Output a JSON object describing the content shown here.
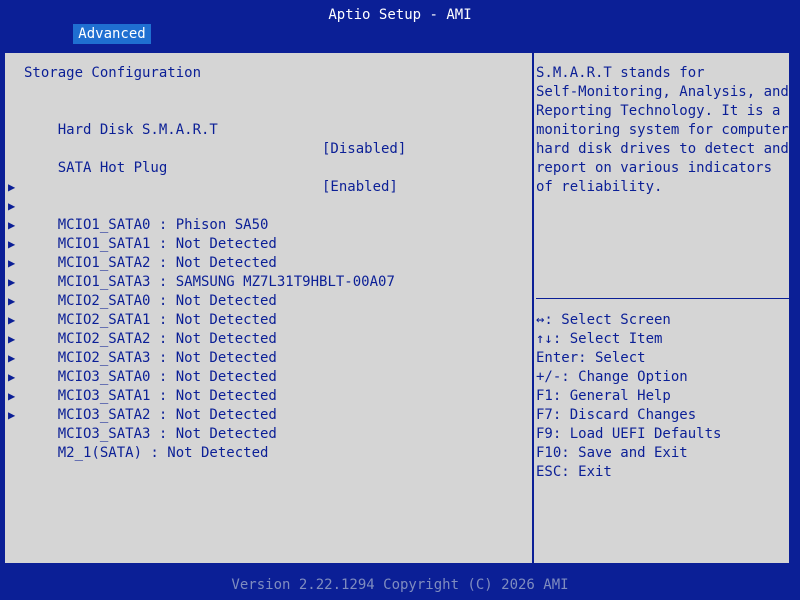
{
  "header": {
    "app_title": "Aptio Setup - AMI",
    "tab_label": "Advanced"
  },
  "main": {
    "section_title": "Storage Configuration",
    "settings": [
      {
        "label": "Hard Disk S.M.A.R.T",
        "value": "[Disabled]"
      },
      {
        "label": "SATA Hot Plug",
        "value": "[Enabled]"
      }
    ],
    "devices": [
      "MCIO1_SATA0 : Phison SA50",
      "MCIO1_SATA1 : Not Detected",
      "MCIO1_SATA2 : Not Detected",
      "MCIO1_SATA3 : SAMSUNG MZ7L31T9HBLT-00A07",
      "MCIO2_SATA0 : Not Detected",
      "MCIO2_SATA1 : Not Detected",
      "MCIO2_SATA2 : Not Detected",
      "MCIO2_SATA3 : Not Detected",
      "MCIO3_SATA0 : Not Detected",
      "MCIO3_SATA1 : Not Detected",
      "MCIO3_SATA2 : Not Detected",
      "MCIO3_SATA3 : Not Detected",
      "M2_1(SATA) : Not Detected"
    ]
  },
  "help": {
    "description": [
      "S.M.A.R.T stands for",
      "Self-Monitoring, Analysis, and",
      "Reporting Technology. It is a",
      "monitoring system for computer",
      "hard disk drives to detect and",
      "report on various indicators",
      "of reliability."
    ],
    "keys": [
      "↔: Select Screen",
      "↑↓: Select Item",
      "Enter: Select",
      "+/-: Change Option",
      "F1: General Help",
      "F7: Discard Changes",
      "F9: Load UEFI Defaults",
      "F10: Save and Exit",
      "ESC: Exit"
    ]
  },
  "footer": {
    "text": "Version 2.22.1294 Copyright (C) 2026 AMI"
  },
  "colors": {
    "background": "#0b1f96",
    "panel": "#d5d5d5",
    "tab_active": "#1f6fd1",
    "footer_text": "#7f8cbf"
  },
  "icons": {
    "submenu": "triangle-right-icon"
  }
}
